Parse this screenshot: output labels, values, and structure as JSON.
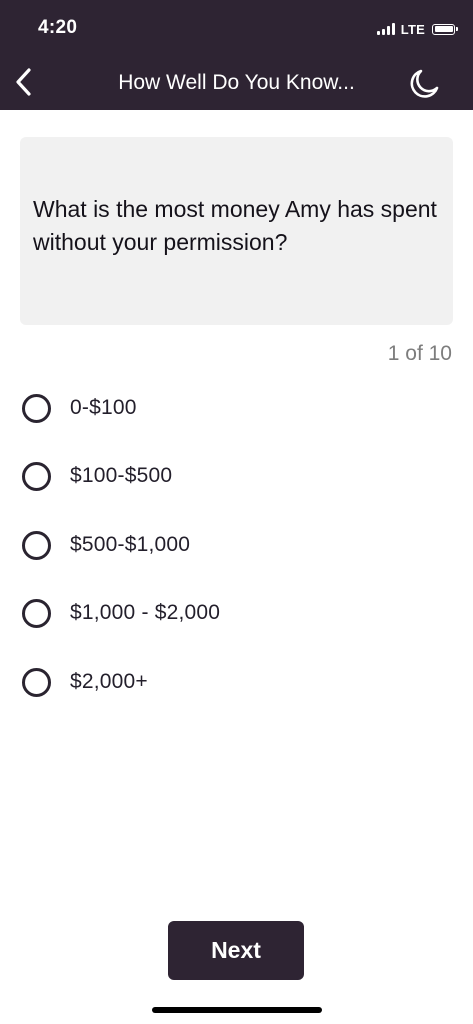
{
  "status_bar": {
    "time": "4:20",
    "network": "LTE",
    "icons": [
      "signal-bars-icon",
      "battery-icon"
    ]
  },
  "nav": {
    "back_icon": "chevron-left-icon",
    "title": "How Well Do You Know...",
    "theme_icon": "moon-icon"
  },
  "question": {
    "text": "What is the most money Amy has spent without your permission?",
    "progress": "1 of 10"
  },
  "options": [
    {
      "label": "0-$100",
      "selected": false
    },
    {
      "label": "$100-$500",
      "selected": false
    },
    {
      "label": "$500-$1,000",
      "selected": false
    },
    {
      "label": "$1,000 - $2,000",
      "selected": false
    },
    {
      "label": "$2,000+",
      "selected": false
    }
  ],
  "actions": {
    "next_label": "Next"
  },
  "colors": {
    "header_bg": "#2e2433",
    "card_bg": "#f1f1f1",
    "progress_text": "#7d7d7d",
    "button_bg": "#2e2433"
  }
}
